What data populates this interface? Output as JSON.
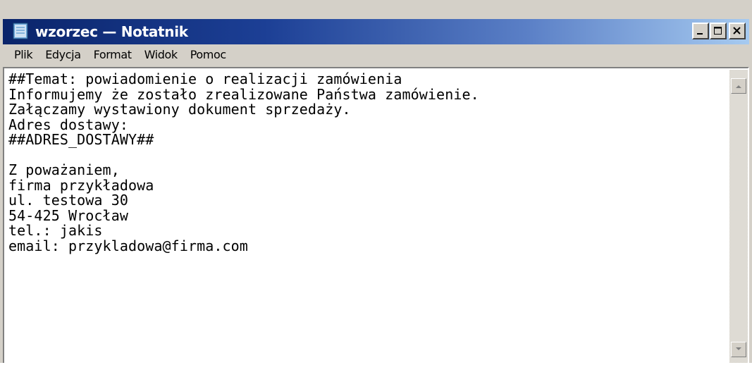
{
  "window": {
    "title": "wzorzec — Notatnik",
    "controls": {
      "minimize": "minimize-icon",
      "maximize": "maximize-icon",
      "close": "close-icon"
    }
  },
  "menubar": {
    "items": [
      "Plik",
      "Edycja",
      "Format",
      "Widok",
      "Pomoc"
    ]
  },
  "editor": {
    "lines": [
      "##Temat: powiadomienie o realizacji zamówienia",
      "Informujemy że zostało zrealizowane Państwa zamówienie.",
      "Załączamy wystawiony dokument sprzedaży.",
      "Adres dostawy:",
      "##ADRES_DOSTAWY##",
      "",
      "Z poważaniem,",
      "firma przykładowa",
      "ul. testowa 30",
      "54-425 Wrocław",
      "tel.: jakis",
      "email: przykladowa@firma.com"
    ]
  },
  "colors": {
    "titlebar_start": "#0a246a",
    "titlebar_end": "#a6caf0",
    "chrome": "#d4d0c8"
  }
}
